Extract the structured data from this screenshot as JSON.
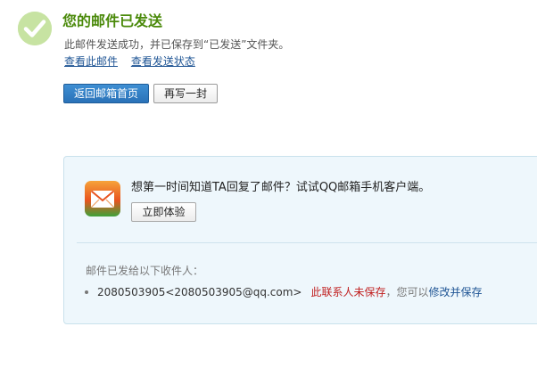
{
  "header": {
    "title": "您的邮件已发送",
    "description": "此邮件发送成功，并已保存到“已发送”文件夹。",
    "links": {
      "view_mail": "查看此邮件",
      "view_status": "查看发送状态"
    }
  },
  "actions": {
    "back_home": "返回邮箱首页",
    "write_again": "再写一封"
  },
  "promo": {
    "text": "想第一时间知道TA回复了邮件？试试QQ邮箱手机客户端。",
    "try_button": "立即体验"
  },
  "recipients": {
    "title": "邮件已发给以下收件人：",
    "items": [
      {
        "address": "2080503905<2080503905@qq.com>",
        "status": "此联系人未保存",
        "hint": "，您可以",
        "action": "修改并保存"
      }
    ]
  },
  "colors": {
    "title_green": "#4b8a0b",
    "link_blue": "#1e5494",
    "warning_red": "#c01f1f",
    "panel_bg": "#eef7fc",
    "primary_button": "#2a72b8"
  },
  "icons": {
    "success": "check-circle-icon",
    "app": "qq-mail-envelope-icon"
  }
}
